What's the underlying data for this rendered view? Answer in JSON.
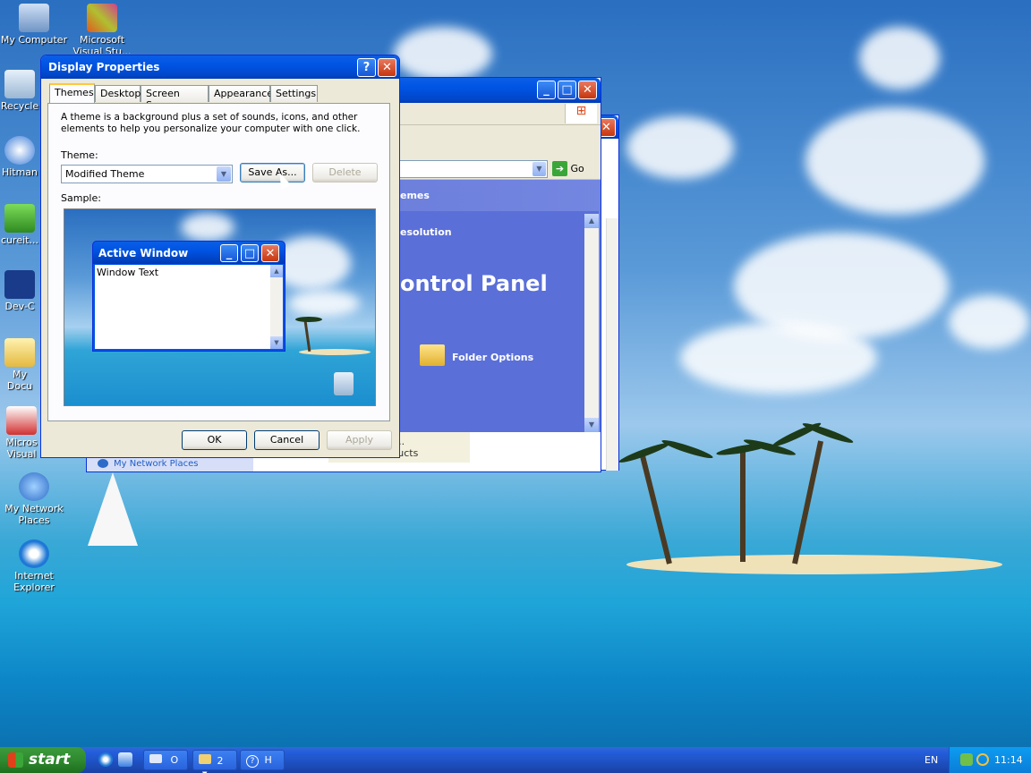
{
  "desktop": {
    "icons": [
      {
        "label": "My Computer",
        "icon": "my-computer-icon"
      },
      {
        "label": "Microsoft Visual Stu...",
        "icon": "visual-studio-icon"
      },
      {
        "label": "Recycle",
        "icon": "recycle-bin-icon"
      },
      {
        "label": "Hitman",
        "icon": "hitman-icon"
      },
      {
        "label": "cureit...",
        "icon": "cureit-icon"
      },
      {
        "label": "Dev-C",
        "icon": "dev-cpp-icon"
      },
      {
        "label": "My Docu",
        "icon": "my-documents-icon"
      },
      {
        "label": "Micros Visual J#",
        "icon": "visual-j-icon"
      },
      {
        "label": "My Network Places",
        "icon": "network-places-icon"
      },
      {
        "label": "Internet Explorer",
        "icon": "internet-explorer-icon"
      }
    ]
  },
  "display_properties": {
    "title": "Display Properties",
    "tabs": [
      "Themes",
      "Desktop",
      "Screen Saver",
      "Appearance",
      "Settings"
    ],
    "active_tab": "Themes",
    "description": "A theme is a background plus a set of sounds, icons, and other elements to help you personalize your computer with one click.",
    "theme_label": "Theme:",
    "theme_value": "Modified Theme",
    "save_as": "Save As...",
    "delete": "Delete",
    "sample_label": "Sample:",
    "sample_window_title": "Active Window",
    "sample_window_text": "Window Text",
    "ok": "OK",
    "cancel": "Cancel",
    "apply": "Apply"
  },
  "control_panel": {
    "go": "Go",
    "task_themes": "emes",
    "task_resolution": "esolution",
    "heading": "ontrol Panel",
    "folder_options": "Folder Options",
    "network_places": "My Network Places",
    "tooltip_line1": "askbar in to ...",
    "tooltip_line2": "ers, Hot Products"
  },
  "taskbar": {
    "start_label": "start",
    "items": [
      "O",
      "2",
      "H"
    ],
    "language": "EN",
    "clock": "11:14"
  }
}
